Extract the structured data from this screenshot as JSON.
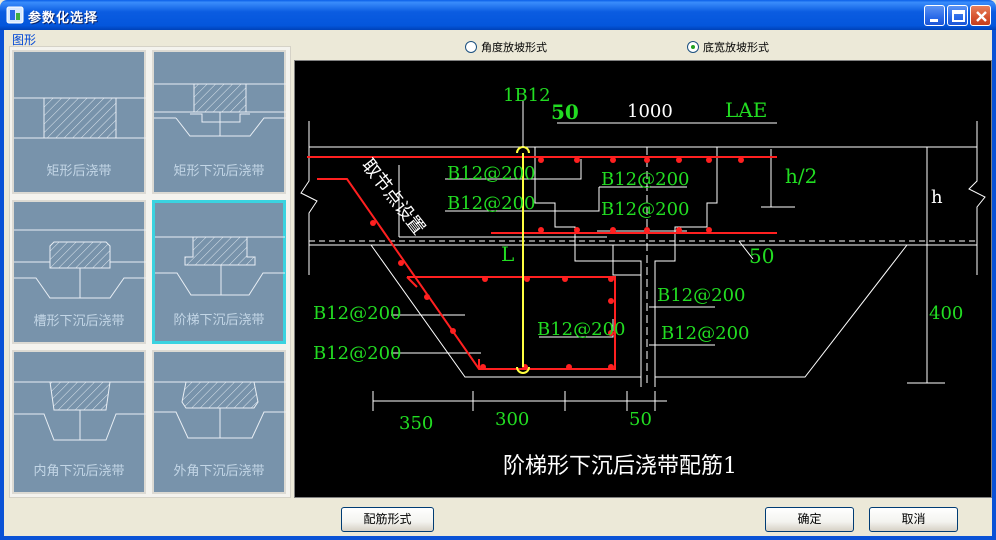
{
  "window": {
    "title": "参数化选择",
    "controls": [
      "minimize",
      "maximize",
      "close"
    ]
  },
  "gallery": {
    "group_label": "图形",
    "items": [
      {
        "label": "矩形后浇带",
        "selected": false
      },
      {
        "label": "矩形下沉后浇带",
        "selected": false
      },
      {
        "label": "槽形下沉后浇带",
        "selected": false
      },
      {
        "label": "阶梯下沉后浇带",
        "selected": true
      },
      {
        "label": "内角下沉后浇带",
        "selected": false
      },
      {
        "label": "外角下沉后浇带",
        "selected": false
      }
    ]
  },
  "slope_options": [
    {
      "label": "角度放坡形式",
      "checked": false
    },
    {
      "label": "底宽放坡形式",
      "checked": true
    }
  ],
  "drawing": {
    "caption": "阶梯形下沉后浇带配筋1",
    "labels": {
      "rebar_1b12": "1B12",
      "dim_50_top": "50",
      "dim_1000": "1000",
      "lae": "LAE",
      "half_h": "h/2",
      "h": "h",
      "l": "L",
      "dim_50_right": "50",
      "dim_400": "400",
      "slant_note": "取节点设置",
      "rebar_1": "B12@200",
      "rebar_2": "B12@200",
      "rebar_3": "B12@200",
      "rebar_4": "B12@200",
      "rebar_5": "B12@200",
      "rebar_6": "B12@200",
      "rebar_7": "B12@200",
      "rebar_8": "B12@200",
      "rebar_9": "B12@200",
      "dim_350": "350",
      "dim_300": "300",
      "dim_50_bottom": "50"
    },
    "colors": {
      "background": "#000000",
      "lines": "#ffffff",
      "rebar": "#ff2020",
      "labels": "#22dd22",
      "anchor": "#ffff40"
    }
  },
  "buttons": {
    "rebar_form": "配筋形式",
    "ok": "确定",
    "cancel": "取消"
  }
}
